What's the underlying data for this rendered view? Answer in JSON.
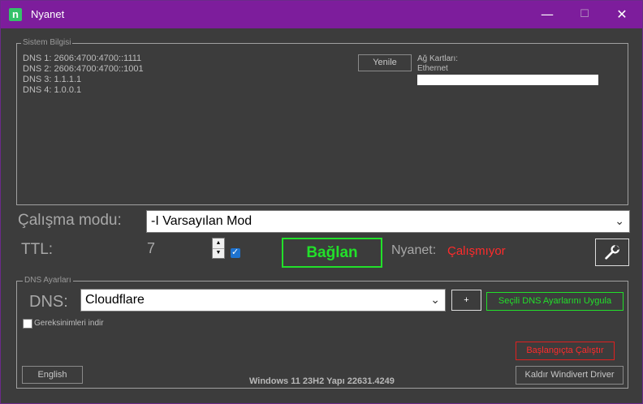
{
  "window": {
    "title": "Nyanet",
    "icon_glyph": "n",
    "minimize": "—",
    "maximize": "☐",
    "close": "✕"
  },
  "system_info": {
    "label": "Sistem Bilgisi",
    "dns_lines": [
      "DNS 1: 2606:4700:4700::1111",
      "DNS 2: 2606:4700:4700::1001",
      "DNS 3: 1.1.1.1",
      "DNS 4: 1.0.0.1"
    ],
    "refresh_button": "Yenile",
    "adapters_label": "Ağ Kartları:",
    "adapters": [
      "Ethernet"
    ]
  },
  "mode": {
    "label": "Çalışma modu:",
    "value": "-I Varsayılan Mod"
  },
  "ttl": {
    "label": "TTL:",
    "value": "7",
    "checkbox_checked": true
  },
  "connect_button": "Bağlan",
  "status": {
    "label": "Nyanet:",
    "value": "Çalışmıyor",
    "color": "#ff2b2b"
  },
  "dns_settings": {
    "label": "DNS Ayarları",
    "dns_label": "DNS:",
    "provider": "Cloudflare",
    "add_button": "+",
    "apply_button": "Seçili DNS Ayarlarını Uygula",
    "requirements_label": "Gereksinimleri indir",
    "requirements_checked": false
  },
  "footer": {
    "language_button": "English",
    "os_info": "Windows 11 23H2 Yapı 22631.4249",
    "startup_button": "Başlangıçta Çalıştır",
    "remove_driver_button": "Kaldır Windivert Driver"
  },
  "colors": {
    "titlebar": "#7d1d9c",
    "accent_green": "#22e02a",
    "accent_red": "#ff2b2b",
    "background": "#3c3c3c"
  }
}
